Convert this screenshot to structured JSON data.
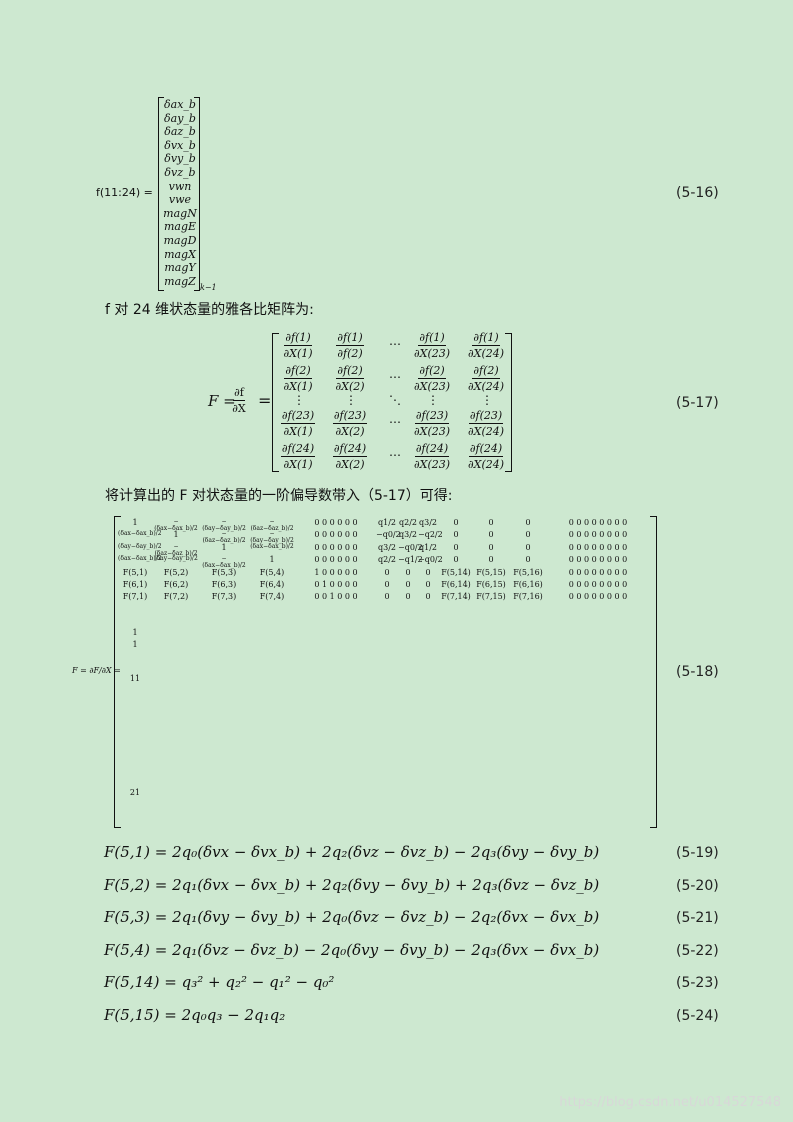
{
  "eq516": {
    "lhs": "f(11:24) =",
    "vector": [
      "δax_b",
      "δay_b",
      "δaz_b",
      "δvx_b",
      "δvy_b",
      "δvz_b",
      "vwn",
      "vwe",
      "magN",
      "magE",
      "magD",
      "magX",
      "magY",
      "magZ"
    ],
    "subscript": "k−1",
    "number": "(5-16)"
  },
  "para1": "f 对 24 维状态量的雅各比矩阵为:",
  "eq517": {
    "lhs_F": "F =",
    "lhs_num": "∂f",
    "lhs_den": "∂X",
    "rows": [
      [
        [
          "∂f(1)",
          "∂X(1)"
        ],
        [
          "∂f(1)",
          "∂f(2)"
        ],
        [
          "⋯",
          ""
        ],
        [
          "∂f(1)",
          "∂X(23)"
        ],
        [
          "∂f(1)",
          "∂X(24)"
        ]
      ],
      [
        [
          "∂f(2)",
          "∂X(1)"
        ],
        [
          "∂f(2)",
          "∂X(2)"
        ],
        [
          "⋯",
          ""
        ],
        [
          "∂f(2)",
          "∂X(23)"
        ],
        [
          "∂f(2)",
          "∂X(24)"
        ]
      ],
      [
        [
          "⋮",
          ""
        ],
        [
          "⋮",
          ""
        ],
        [
          "⋱",
          ""
        ],
        [
          "⋮",
          ""
        ],
        [
          "⋮",
          ""
        ]
      ],
      [
        [
          "∂f(23)",
          "∂X(1)"
        ],
        [
          "∂f(23)",
          "∂X(2)"
        ],
        [
          "⋯",
          ""
        ],
        [
          "∂f(23)",
          "∂X(23)"
        ],
        [
          "∂f(23)",
          "∂X(24)"
        ]
      ],
      [
        [
          "∂f(24)",
          "∂X(1)"
        ],
        [
          "∂f(24)",
          "∂X(2)"
        ],
        [
          "⋯",
          ""
        ],
        [
          "∂f(24)",
          "∂X(23)"
        ],
        [
          "∂f(24)",
          "∂X(24)"
        ]
      ]
    ],
    "number": "(5-17)"
  },
  "para2": "将计算出的 F 对状态量的一阶偏导数带入（5-17）可得:",
  "eq518": {
    "lhs": "F = ∂F/∂X =",
    "rows": [
      [
        "1",
        "−(δax−δax_b)/2",
        "−(δay−δay_b)/2",
        "−(δaz−δaz_b)/2",
        "0 0 0 0 0 0",
        "q1/2",
        "q2/2",
        "q3/2",
        "0",
        "0",
        "0",
        "0 0 0 0 0 0 0 0"
      ],
      [
        "(δax−δax_b)/2",
        "1",
        "−(δaz−δaz_b)/2",
        "−(δay−δay_b)/2",
        "0 0 0 0 0 0",
        "−q0/2",
        "q3/2",
        "−q2/2",
        "0",
        "0",
        "0",
        "0 0 0 0 0 0 0 0"
      ],
      [
        "(δay−δay_b)/2",
        "−(δaz−δaz_b)/2",
        "1",
        "(δax−δax_b)/2",
        "0 0 0 0 0 0",
        "q3/2",
        "−q0/2",
        "q1/2",
        "0",
        "0",
        "0",
        "0 0 0 0 0 0 0 0"
      ],
      [
        "(δax−δax_b)/2",
        "(δay−δay_b)/2",
        "−(δax−δax_b)/2",
        "1",
        "0 0 0 0 0 0",
        "q2/2",
        "−q1/2",
        "−q0/2",
        "0",
        "0",
        "0",
        "0 0 0 0 0 0 0 0"
      ],
      [
        "F(5,1)",
        "F(5,2)",
        "F(5,3)",
        "F(5,4)",
        "1 0 0 0 0 0",
        "0",
        "0",
        "0",
        "F(5,14)",
        "F(5,15)",
        "F(5,16)",
        "0 0 0 0 0 0 0 0"
      ],
      [
        "F(6,1)",
        "F(6,2)",
        "F(6,3)",
        "F(6,4)",
        "0 1 0 0 0 0",
        "0",
        "0",
        "0",
        "F(6,14)",
        "F(6,15)",
        "F(6,16)",
        "0 0 0 0 0 0 0 0"
      ],
      [
        "F(7,1)",
        "F(7,2)",
        "F(7,3)",
        "F(7,4)",
        "0 0 1 0 0 0",
        "0",
        "0",
        "0",
        "F(7,14)",
        "F(7,15)",
        "F(7,16)",
        "0 0 0 0 0 0 0 0"
      ]
    ],
    "extra": [
      "1",
      "1",
      "11",
      "21"
    ],
    "number": "(5-18)"
  },
  "equations": [
    {
      "text": "F(5,1) = 2q₀(δvx − δvx_b) + 2q₂(δvz − δvz_b) − 2q₃(δvy − δvy_b)",
      "number": "(5-19)"
    },
    {
      "text": "F(5,2) = 2q₁(δvx − δvx_b) + 2q₂(δvy − δvy_b) + 2q₃(δvz − δvz_b)",
      "number": "(5-20)"
    },
    {
      "text": "F(5,3) = 2q₁(δvy − δvy_b) + 2q₀(δvz − δvz_b) − 2q₂(δvx − δvx_b)",
      "number": "(5-21)"
    },
    {
      "text": "F(5,4) = 2q₁(δvz − δvz_b) − 2q₀(δvy − δvy_b) − 2q₃(δvx − δvx_b)",
      "number": "(5-22)"
    },
    {
      "text": "F(5,14) = q₃² + q₂² − q₁² − q₀²",
      "number": "(5-23)"
    },
    {
      "text": "F(5,15) = 2q₀q₃ − 2q₁q₂",
      "number": "(5-24)"
    }
  ],
  "watermark": "https://blog.csdn.net/u014527548"
}
